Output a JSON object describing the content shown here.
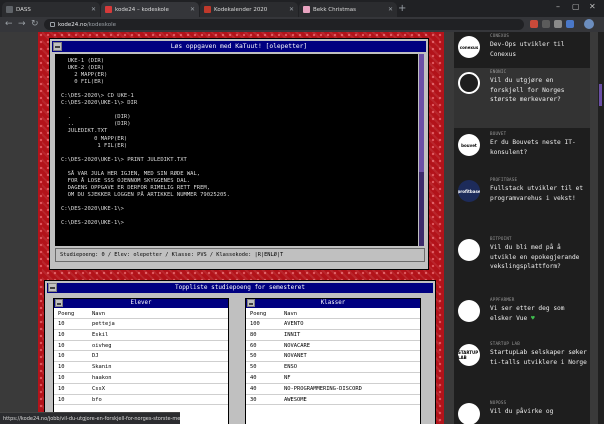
{
  "browser": {
    "tabs": [
      {
        "title": "DASS",
        "active": false
      },
      {
        "title": "kode24 – kodeskole",
        "active": true
      },
      {
        "title": "Kodekalender 2020",
        "active": false
      },
      {
        "title": "Bekk Christmas",
        "active": false
      }
    ],
    "url_host": "kode24.no",
    "url_path": "/kodeskole"
  },
  "dos": {
    "title": "Løs oppgaven med KaTuut! [olepetter]",
    "lines": [
      "  UKE-1 (DIR)",
      "  UKE-2 (DIR)",
      "    2 MAPP(ER)",
      "    0 FIL(ER)",
      "",
      "C:\\DES-2020\\> CD UKE-1",
      "C:\\DES-2020\\UKE-1\\> DIR",
      "",
      "  .             (DIR)",
      "  ..            (DIR)",
      "  JULEDIKT.TXT",
      "          0 MAPP(ER)",
      "           1 FIL(ER)",
      "",
      "C:\\DES-2020\\UKE-1\\> PRINT JULEDIKT.TXT",
      "",
      "  SÅ VAR JULA HER IGJEN, MED SIN RØDE WAL,",
      "  FOR Å LOSE SSS OJENNOM SKYGGENES DAL.",
      "  DAGENS OPPGAVE ER DERFOR RIMELIG RETT FREM,",
      "  OM DU SJEKKER LOGGEN PÅ ARTIKKEL NUMMER 79025205.",
      "",
      "C:\\DES-2020\\UKE-1\\> ",
      "",
      "C:\\DES-2020\\UKE-1\\>"
    ],
    "status": "Studiepoeng: 0 / Elev: olepetter / Klasse: PVS / Klassekode: |R|ENLØ|T"
  },
  "toppliste": {
    "title": "Toppliste studiepoeng for semesteret",
    "elever": {
      "heading": "Elever",
      "col_poeng": "Poeng",
      "col_navn": "Navn",
      "rows": [
        {
          "poeng": "10",
          "navn": "petteja"
        },
        {
          "poeng": "10",
          "navn": "Eskil"
        },
        {
          "poeng": "10",
          "navn": "oivheg"
        },
        {
          "poeng": "10",
          "navn": "DJ"
        },
        {
          "poeng": "10",
          "navn": "Skanin"
        },
        {
          "poeng": "10",
          "navn": "haakon"
        },
        {
          "poeng": "10",
          "navn": "CssX"
        },
        {
          "poeng": "10",
          "navn": "bfo"
        }
      ]
    },
    "klasser": {
      "heading": "Klasser",
      "col_poeng": "Poeng",
      "col_navn": "Navn",
      "rows": [
        {
          "poeng": "100",
          "navn": "AVENTO"
        },
        {
          "poeng": "80",
          "navn": "INNIT"
        },
        {
          "poeng": "60",
          "navn": "NOVACARE"
        },
        {
          "poeng": "50",
          "navn": "NOVANET"
        },
        {
          "poeng": "50",
          "navn": "ENSO"
        },
        {
          "poeng": "40",
          "navn": "NF"
        },
        {
          "poeng": "40",
          "navn": "NO-PROGRAMMERING-DISCORD"
        },
        {
          "poeng": "30",
          "navn": "AWESOME"
        }
      ]
    }
  },
  "status_url": "https://kode24.no/jobb/vil-du-utgjore-en-forskjell-for-norges-storste-merkevarer/73038...",
  "sidebar": [
    {
      "company": "CONEXUS",
      "headline": "Dev-Ops utvikler til Conexus",
      "logo": "conexus",
      "logo_bg": "#ffffff"
    },
    {
      "company": "ENONIC",
      "headline": "Vil du utgjøre en forskjell for Norges største merkevarer?",
      "logo": "",
      "logo_bg": "#1e1e1e"
    },
    {
      "company": "BOUVET",
      "headline": "Er du Bouvets neste IT-konsulent?",
      "logo": "bouvet",
      "logo_bg": "#ffffff"
    },
    {
      "company": "PROFITBASE",
      "headline": "Fullstack utvikler til et programvarehus i vekst!",
      "logo": "profitbase",
      "logo_bg": "#1d2b5a"
    },
    {
      "company": "BITPOINT",
      "headline": "Vil du bli med på å utvikle en epokegjerande vekslingsplattform?",
      "logo": "",
      "logo_bg": "#ffffff"
    },
    {
      "company": "APPFARMER",
      "headline": "Vi ser etter deg som elsker Vue",
      "logo": "",
      "logo_bg": "#ffffff"
    },
    {
      "company": "STARTUP LAB",
      "headline": "StartupLab selskaper søker ti-talls utviklere i Norge",
      "logo": "STARTUP LAB",
      "logo_bg": "#ffffff"
    },
    {
      "company": "NOPOSS",
      "headline": "Vil du påvirke og",
      "logo": "",
      "logo_bg": "#ffffff"
    }
  ]
}
